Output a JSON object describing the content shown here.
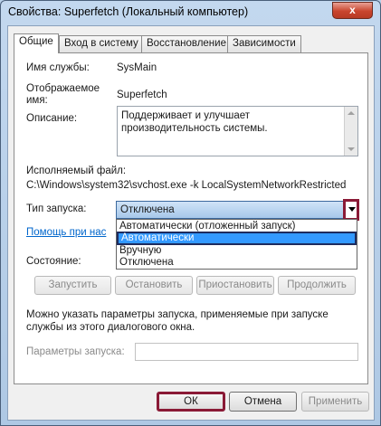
{
  "window": {
    "title": "Свойства: Superfetch (Локальный компьютер)",
    "close_glyph": "x"
  },
  "tabs": [
    {
      "label": "Общие",
      "active": true
    },
    {
      "label": "Вход в систему",
      "active": false
    },
    {
      "label": "Восстановление",
      "active": false
    },
    {
      "label": "Зависимости",
      "active": false
    }
  ],
  "general": {
    "service_name_label": "Имя службы:",
    "service_name_value": "SysMain",
    "display_name_label_1": "Отображаемое",
    "display_name_label_2": "имя:",
    "display_name_value": "Superfetch",
    "description_label": "Описание:",
    "description_value": "Поддерживает и улучшает производительность системы.",
    "exe_label": "Исполняемый файл:",
    "exe_value": "C:\\Windows\\system32\\svchost.exe -k LocalSystemNetworkRestricted",
    "startup_type_label": "Тип запуска:",
    "startup_type_value": "Отключена",
    "startup_options": [
      "Автоматически (отложенный запуск)",
      "Автоматически",
      "Вручную",
      "Отключена"
    ],
    "highlighted_option": "Автоматически",
    "help_link": "Помощь при нас",
    "status_label": "Состояние:",
    "buttons": {
      "start": "Запустить",
      "stop": "Остановить",
      "pause": "Приостановить",
      "resume": "Продолжить"
    },
    "note_line1": "Можно указать параметры запуска, применяемые при запуске",
    "note_line2": "службы из этого диалогового окна.",
    "params_label": "Параметры запуска:",
    "params_value": ""
  },
  "footer": {
    "ok": "ОК",
    "cancel": "Отмена",
    "apply": "Применить"
  },
  "colors": {
    "highlight": "#3399ff",
    "callout": "#8a1a36",
    "link": "#0066cc"
  }
}
